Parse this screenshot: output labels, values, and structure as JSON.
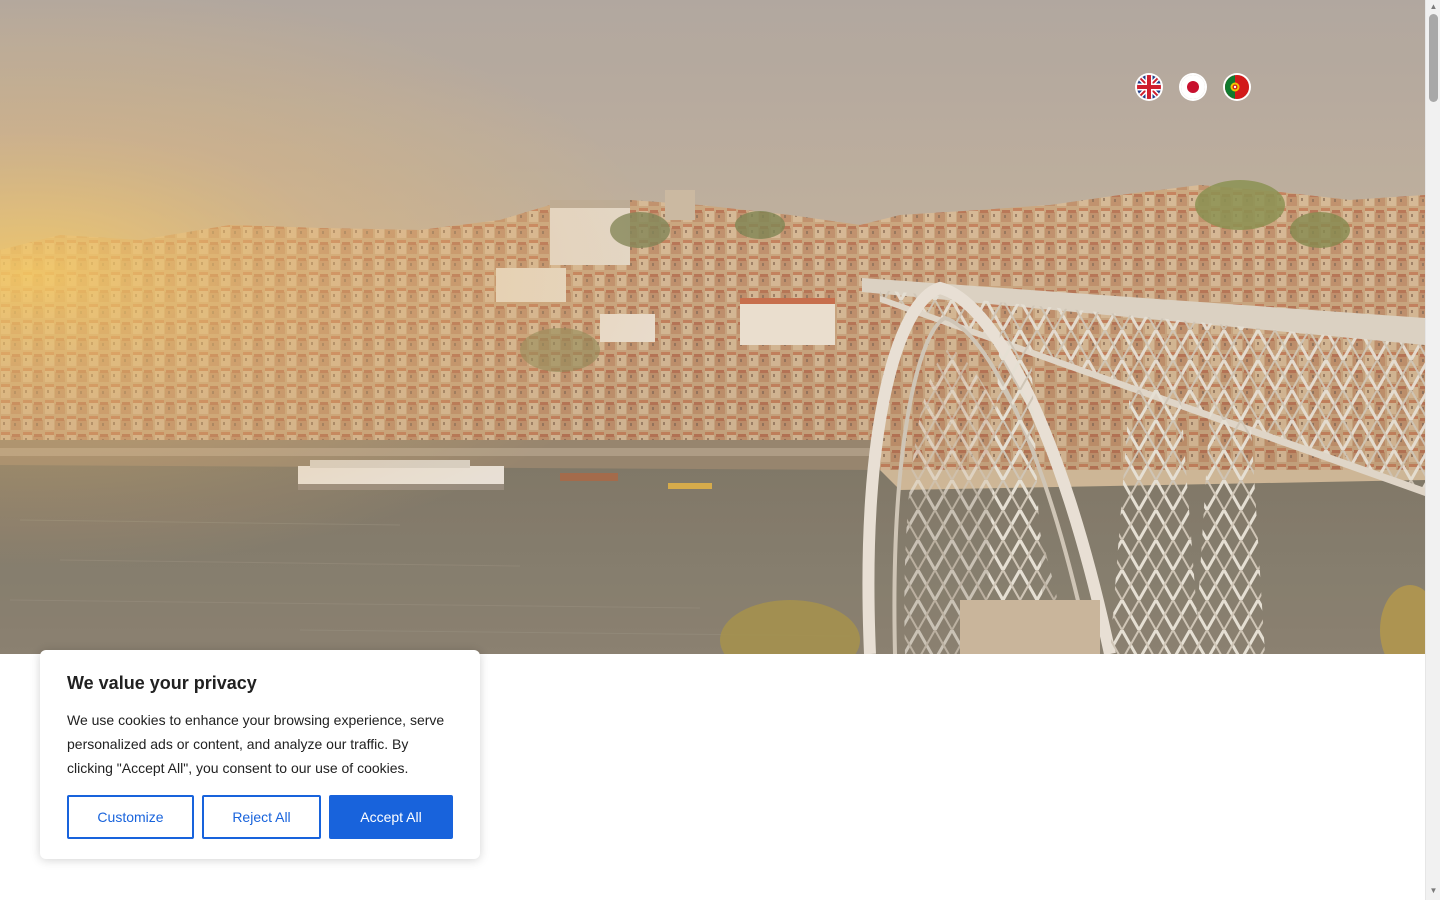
{
  "hero": {
    "image_description_icon": "porto-bridge-photo"
  },
  "language_switcher": {
    "items": [
      {
        "icon": "uk-flag-icon",
        "lang": "English"
      },
      {
        "icon": "japan-flag-icon",
        "lang": "Japanese"
      },
      {
        "icon": "portugal-flag-icon",
        "lang": "Portuguese"
      }
    ]
  },
  "cookie_banner": {
    "title": "We value your privacy",
    "text": "We use cookies to enhance your browsing experience, serve personalized ads or content, and analyze our traffic. By clicking \"Accept All\", you consent to our use of cookies.",
    "customize_label": "Customize",
    "reject_label": "Reject All",
    "accept_label": "Accept All",
    "accent_color": "#1863dc"
  },
  "scrollbar": {
    "up_icon": "chevron-up-icon",
    "down_icon": "chevron-down-icon"
  }
}
